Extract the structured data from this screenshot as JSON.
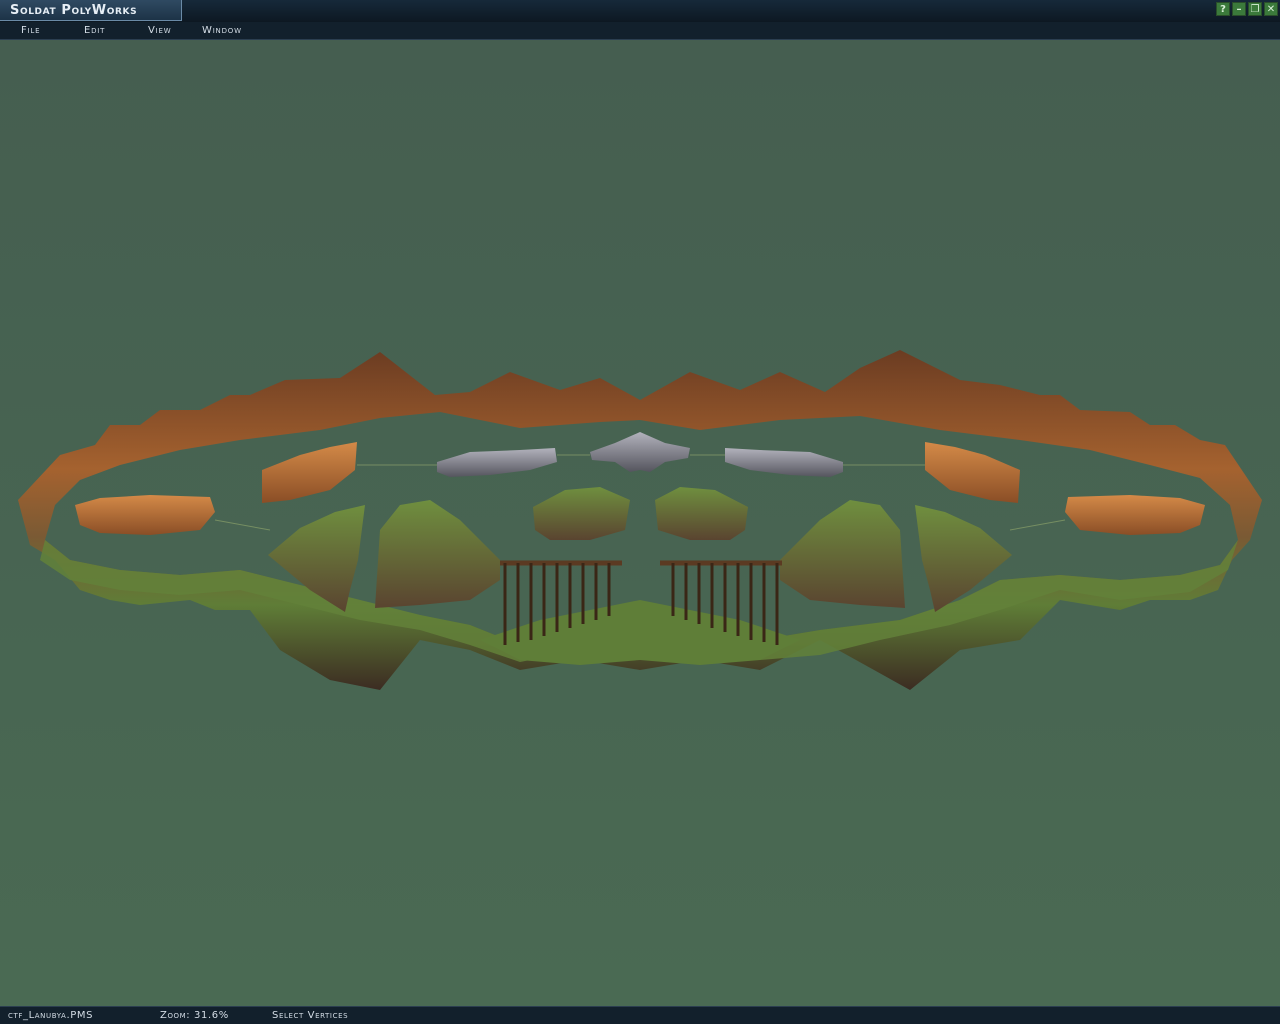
{
  "app": {
    "title": "Soldat PolyWorks"
  },
  "window_controls": {
    "help": "?",
    "minimize": "–",
    "restore": "❐",
    "close": "✕"
  },
  "menu": {
    "items": [
      "File",
      "Edit",
      "View",
      "Window"
    ]
  },
  "status": {
    "filename": "ctf_Lanubya.PMS",
    "zoom": "Zoom: 31.6%",
    "mode": "Select Vertices"
  },
  "colors": {
    "background": "#4a6452",
    "dirt": "#8a5430",
    "grass": "#5e7e3a",
    "rock": "#8c8c94",
    "orange_rock": "#c67a3c"
  }
}
